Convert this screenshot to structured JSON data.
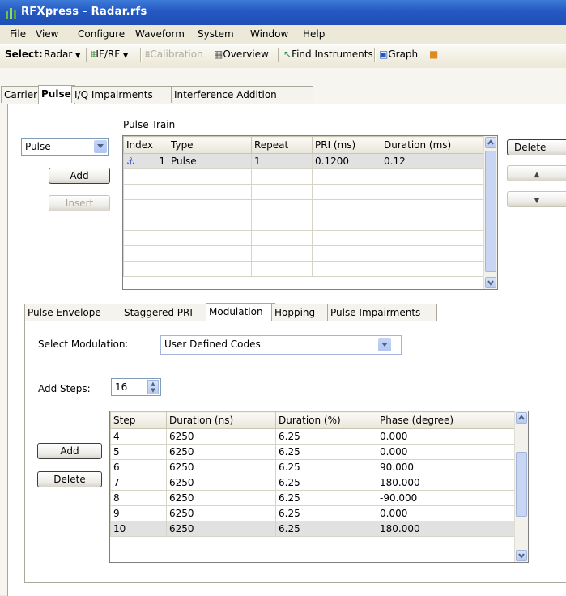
{
  "window": {
    "title": "RFXpress - Radar.rfs"
  },
  "menu": [
    "File",
    "View",
    "Configure",
    "Waveform",
    "System",
    "Window",
    "Help"
  ],
  "toolbar": {
    "select_label": "Select:",
    "select_value": "Radar",
    "ifrf": "IF/RF",
    "calibration": "Calibration",
    "overview": "Overview",
    "find_instruments": "Find Instruments",
    "graph": "Graph"
  },
  "top_tabs": [
    "Carrier",
    "Pulse",
    "I/Q Impairments",
    "Interference Addition"
  ],
  "pulse_train": {
    "label": "Pulse Train",
    "type_select": "Pulse",
    "add": "Add",
    "insert": "Insert",
    "delete": "Delete",
    "columns": [
      "Index",
      "Type",
      "Repeat",
      "PRI (ms)",
      "Duration (ms)"
    ],
    "rows": [
      {
        "index": "1",
        "type": "Pulse",
        "repeat": "1",
        "pri": "0.1200",
        "duration": "0.12"
      }
    ]
  },
  "sub_tabs": [
    "Pulse Envelope",
    "Staggered PRI",
    "Modulation",
    "Hopping",
    "Pulse Impairments"
  ],
  "modulation": {
    "select_label": "Select Modulation:",
    "select_value": "User Defined Codes",
    "add_steps_label": "Add Steps:",
    "add_steps_value": "16",
    "add": "Add",
    "delete": "Delete",
    "columns": [
      "Step",
      "Duration (ns)",
      "Duration (%)",
      "Phase (degree)"
    ],
    "rows": [
      [
        "4",
        "6250",
        "6.25",
        "0.000"
      ],
      [
        "5",
        "6250",
        "6.25",
        "0.000"
      ],
      [
        "6",
        "6250",
        "6.25",
        "90.000"
      ],
      [
        "7",
        "6250",
        "6.25",
        "180.000"
      ],
      [
        "8",
        "6250",
        "6.25",
        "-90.000"
      ],
      [
        "9",
        "6250",
        "6.25",
        "0.000"
      ],
      [
        "10",
        "6250",
        "6.25",
        "180.000"
      ]
    ]
  }
}
